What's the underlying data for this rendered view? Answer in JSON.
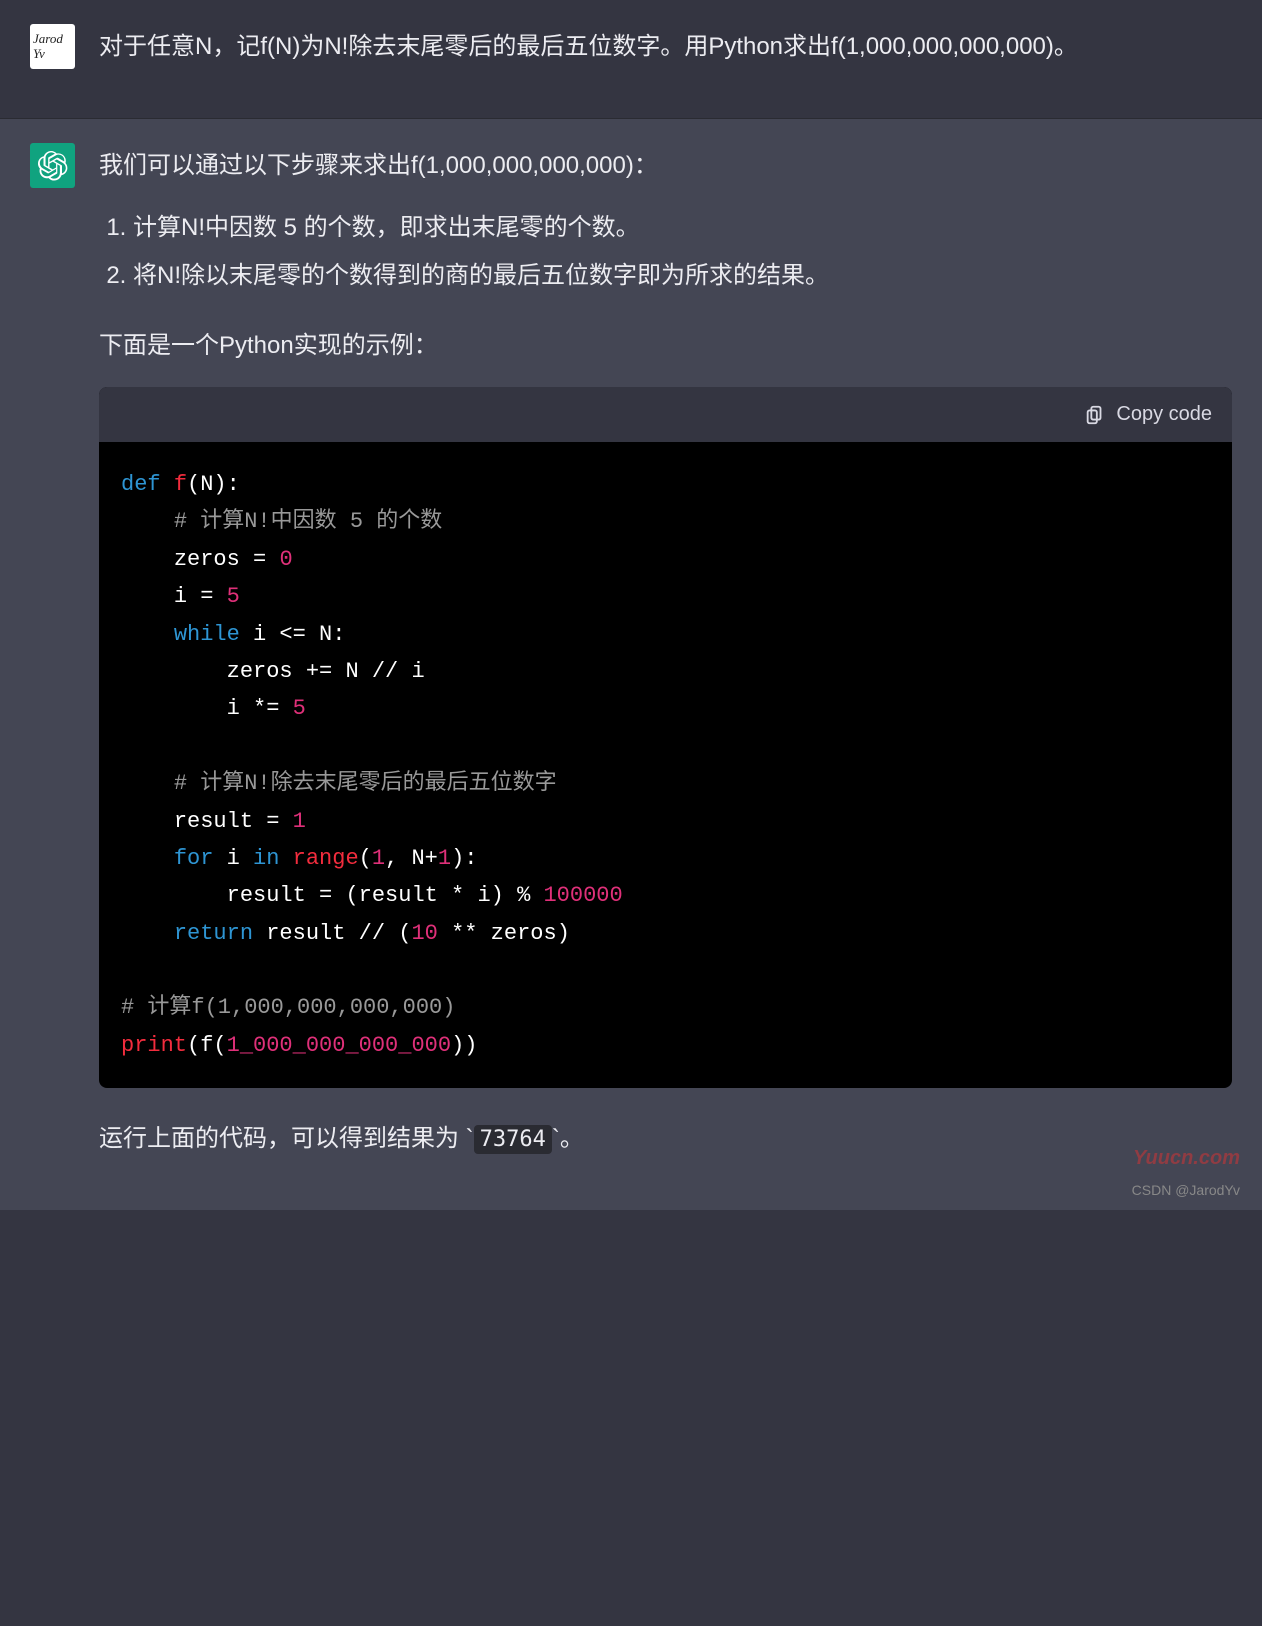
{
  "user": {
    "avatar_text": "Jarod Yv",
    "message": "对于任意N，记f(N)为N!除去末尾零后的最后五位数字。用Python求出f(1,000,000,000,000)。"
  },
  "assistant": {
    "intro": "我们可以通过以下步骤来求出f(1,000,000,000,000)：",
    "steps": [
      "计算N!中因数 5 的个数，即求出末尾零的个数。",
      "将N!除以末尾零的个数得到的商的最后五位数字即为所求的结果。"
    ],
    "code_intro": "下面是一个Python实现的示例：",
    "copy_label": "Copy code",
    "code_tokens": {
      "def": "def",
      "f": "f",
      "lp1": "(N):",
      "c1": "# 计算N!中因数 5 的个数",
      "zeros_eq": "zeros = ",
      "zero": "0",
      "i_eq": "i = ",
      "five": "5",
      "while": "while",
      "cond": " i <= N:",
      "zp": "zeros += N // i",
      "imul": "i *= ",
      "five2": "5",
      "c2": "# 计算N!除去末尾零后的最后五位数字",
      "res1": "result = ",
      "one": "1",
      "for": "for",
      "in": "in",
      "range": "range",
      "args": "(",
      "one2": "1",
      "comma": ", N+",
      "one3": "1",
      "rp": "):",
      "resline": "result = (result * i) % ",
      "modnum": "100000",
      "return": "return",
      "retrest": " result // (",
      "ten": "10",
      "pow": " ** zeros)",
      "c3": "# 计算f(1,000,000,000,000)",
      "print": "print",
      "po": "(f(",
      "bignum": "1_000_000_000_000",
      "pc": "))"
    },
    "outro_before": "运行上面的代码，可以得到结果为 `",
    "result_value": "73764",
    "outro_after": "`。"
  },
  "watermarks": {
    "wm1": "Yuucn.com",
    "wm2": "CSDN @JarodYv"
  }
}
